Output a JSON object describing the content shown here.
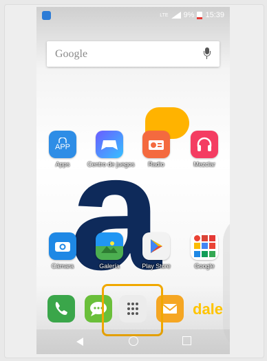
{
  "status_bar": {
    "network": "LTE",
    "battery": "9%",
    "time": "15:39"
  },
  "search": {
    "label": "Google"
  },
  "apps_row1": [
    {
      "label": "Apps",
      "icon": "bag-icon",
      "color": "#2e8de6"
    },
    {
      "label": "Centro de juegos",
      "icon": "gamepad-icon",
      "color": "#ffffff"
    },
    {
      "label": "Radio",
      "icon": "radio-icon",
      "color": "#f46a3f"
    },
    {
      "label": "Mezclar",
      "icon": "headphones-icon",
      "color": "#f43d62"
    }
  ],
  "apps_row2": [
    {
      "label": "Cámara",
      "icon": "camera-icon",
      "color": "#1e88e5"
    },
    {
      "label": "Galería",
      "icon": "gallery-icon",
      "color": "#4caf50"
    },
    {
      "label": "Play Store",
      "icon": "play-store-icon",
      "color": "#f2f2f2"
    },
    {
      "label": "Google",
      "icon": "google-folder-icon",
      "color": "#ffffff"
    }
  ],
  "dock": {
    "app_icon_text": "APP",
    "brand_text": "dale",
    "items": [
      {
        "name": "phone",
        "color": "#3aa64a"
      },
      {
        "name": "messages",
        "color": "#6abf3a"
      },
      {
        "name": "app-drawer",
        "color": "#eeeeee"
      },
      {
        "name": "email",
        "color": "#f5a623"
      }
    ]
  },
  "highlight_color": "#f0a800"
}
